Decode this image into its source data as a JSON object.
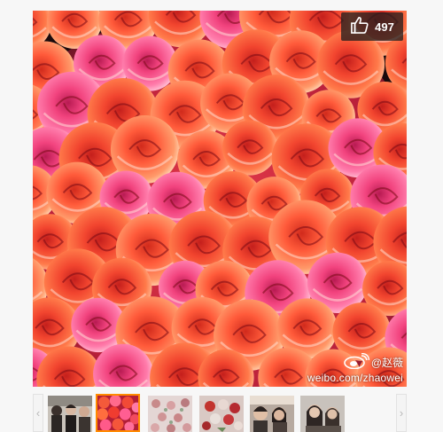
{
  "viewer": {
    "like_count": "497",
    "like_icon": "thumbs-up-icon",
    "watermark_handle": "@赵薇",
    "watermark_url": "weibo.com/zhaowei",
    "watermark_icon": "weibo-logo-icon"
  },
  "filmstrip": {
    "prev_label": "‹",
    "next_label": "›",
    "selected_index": 1,
    "thumbnail_count": 6
  },
  "colors": {
    "selected_border": "#ff8a00",
    "rose_primary": "#f0463c",
    "rose_secondary": "#ff5fa0"
  }
}
